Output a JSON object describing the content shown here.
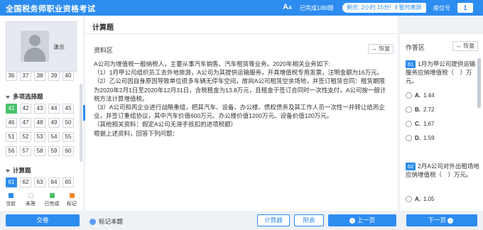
{
  "header": {
    "title": "全国税务师职业资格考试",
    "font_icon": "A",
    "font_icon_small": "A",
    "progress": "已完成1/80题",
    "timer": "剩余: 2小时 15分钟",
    "pause_label": "暂时离屏",
    "seat_label": "座位号",
    "seat_number": "1"
  },
  "user": {
    "name": "演示"
  },
  "nav": {
    "row_top": [
      "36",
      "37",
      "38",
      "39",
      "40"
    ],
    "multi_section": "多项选择题",
    "multi_rows": [
      [
        "41",
        "42",
        "43",
        "44",
        "45"
      ],
      [
        "46",
        "47",
        "48",
        "49",
        "50"
      ],
      [
        "51",
        "52",
        "53",
        "54",
        "55"
      ],
      [
        "56",
        "57",
        "58",
        "59",
        "60"
      ]
    ],
    "calc_section": "计算题",
    "calc_row": [
      "61",
      "62",
      "63",
      "64",
      "65"
    ]
  },
  "legend": [
    {
      "label": "当前",
      "color": "#2d8cf0"
    },
    {
      "label": "未答",
      "color": "#ffffff"
    },
    {
      "label": "已完成",
      "color": "#47c26a"
    },
    {
      "label": "标记",
      "color": "#f08a2d"
    }
  ],
  "material": {
    "section_title": "计算题",
    "label": "资料区",
    "restore": "恢复",
    "paragraphs": [
      "A公司为增值税一般纳税人，主要从事汽车销售、汽车租赁等业务。2020年相关业务如下:",
      "（1）1月甲公司组织员工去外地旅游，A公司为其提供运输服务，开具增值税专用发票，注明金额为16万元。",
      "（2）乙公司因自身原因导致单位很多车辆无停车空间，故向A公司租赁空余场地，并签订租赁合同：租赁期限为2020年2月1日至2020年12月31日，含税租金为13.8万元，且租金于签订合同时一次性支付，A公司按一般计税方法计算增值税。",
      "（3）A公司和丙企业进行战略重组，把其汽车、设备、办公楼、债权债务及其工作人员一次性一并转让给丙企业，并签订重组协议，其中汽车价值600万元、办公楼价值1200万元、设备价值120万元。",
      "（其他相关资料：假定A公司无滞手抵扣的进项税额）",
      "根据上述资料，回答下列问题："
    ]
  },
  "answer": {
    "label": "作答区",
    "restore": "恢复",
    "q1": {
      "number": "61",
      "text": "1月为甲公司提供运输服务应纳增值税（　）万元。",
      "options": [
        {
          "letter": "A.",
          "value": "1.44"
        },
        {
          "letter": "B.",
          "value": "2.72"
        },
        {
          "letter": "C.",
          "value": "1.67"
        },
        {
          "letter": "D.",
          "value": "1.59"
        }
      ]
    },
    "q2": {
      "number": "62",
      "text": "2月A公司对外出租场地应纳增值税（　）万元。",
      "options": [
        {
          "letter": "A.",
          "value": "1.05"
        }
      ]
    }
  },
  "footer": {
    "submit": "交卷",
    "mark": "标记本题",
    "calculator": "计算器",
    "attachment": "附表",
    "prev": "上一页",
    "next": "下一页"
  }
}
